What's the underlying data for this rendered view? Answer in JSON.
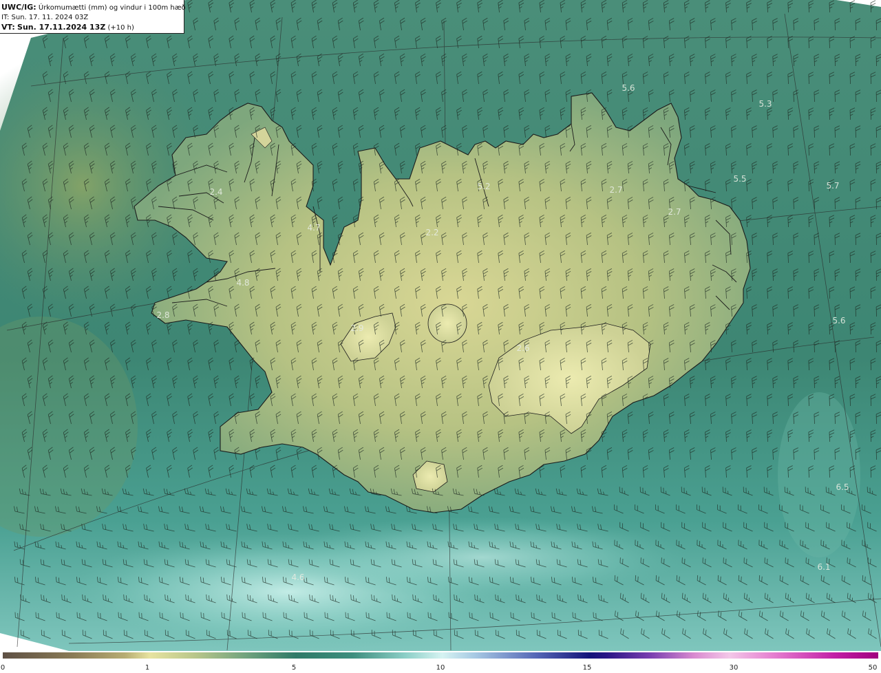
{
  "header": {
    "product": "UWC/IG:",
    "title": "Úrkomumætti (mm) og vindur i 100m hæð",
    "it_label": "IT:",
    "it_value": "Sun. 17. 11. 2024 03Z",
    "vt_label": "VT:",
    "vt_value": "Sun. 17.11.2024 13Z",
    "vt_offset": "(+10 h)"
  },
  "legend": {
    "ticks": [
      "0",
      "1",
      "5",
      "10",
      "15",
      "30",
      "50"
    ]
  },
  "point_values": [
    "5.6",
    "5.3",
    "5.2",
    "2.7",
    "2.7",
    "5.5",
    "5.7",
    "2.4",
    "4.7",
    "2.2",
    "4.8",
    "2.8",
    "2.9",
    "2.6",
    "5.6",
    "6.5",
    "6.1",
    "4.6"
  ],
  "colors": {
    "sea": "#3b8473",
    "land": "#b9c385",
    "coast": "#1b1b1b"
  },
  "icons": {
    "wind": "wind-barb-icon"
  }
}
